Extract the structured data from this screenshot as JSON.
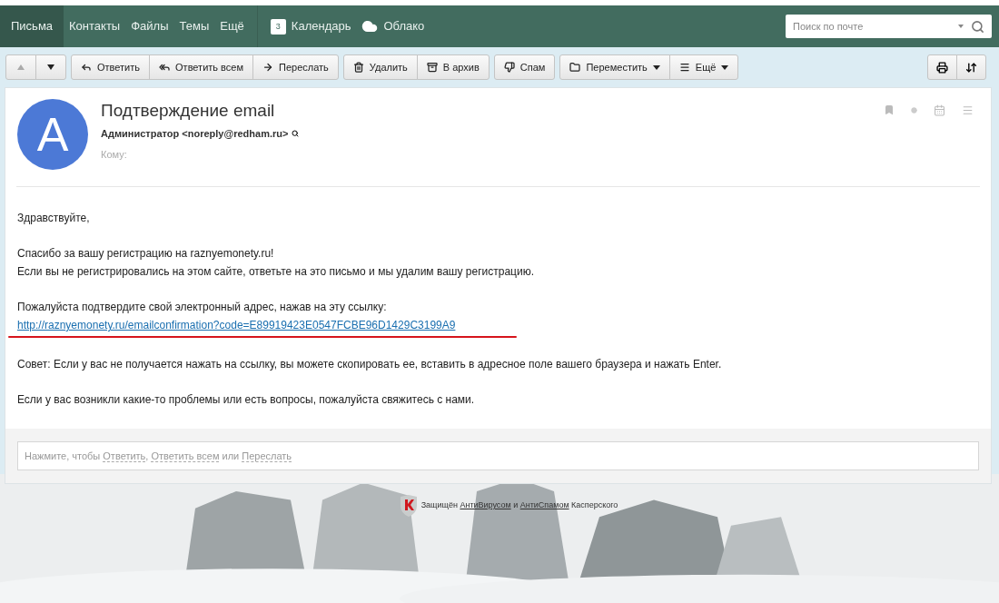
{
  "nav": {
    "items": [
      {
        "label": "Письма",
        "selected": true,
        "kind": "text"
      },
      {
        "label": "Контакты",
        "selected": false,
        "kind": "text"
      },
      {
        "label": "Файлы",
        "selected": false,
        "kind": "text"
      },
      {
        "label": "Темы",
        "selected": false,
        "kind": "text"
      },
      {
        "label": "Ещё",
        "selected": false,
        "kind": "text"
      },
      {
        "label": "Календарь",
        "selected": false,
        "kind": "calendar",
        "badge": "3"
      },
      {
        "label": "Облако",
        "selected": false,
        "kind": "cloud"
      }
    ],
    "search": {
      "placeholder": "Поиск по почте"
    }
  },
  "toolbar": {
    "groups": [
      [
        {
          "kind": "up",
          "disabled": true
        },
        {
          "kind": "down",
          "disabled": false
        }
      ],
      [
        {
          "kind": "reply",
          "label": "Ответить"
        },
        {
          "kind": "reply-all",
          "label": "Ответить всем"
        },
        {
          "kind": "forward",
          "label": "Переслать"
        }
      ],
      [
        {
          "kind": "delete",
          "label": "Удалить"
        },
        {
          "kind": "archive",
          "label": "В архив"
        }
      ],
      [
        {
          "kind": "spam",
          "label": "Спам"
        }
      ],
      [
        {
          "kind": "move",
          "label": "Переместить",
          "dropdown": true
        },
        {
          "kind": "more",
          "label": "Ещё",
          "dropdown": true
        }
      ]
    ],
    "right": [
      {
        "kind": "print"
      },
      {
        "kind": "convert"
      }
    ]
  },
  "message": {
    "avatar": "A",
    "subject": "Подтверждение email",
    "sender": "Администратор <noreply@redham.ru>",
    "to_label": "Кому:",
    "body": [
      {
        "kind": "para",
        "lines": [
          "Здравствуйте,"
        ]
      },
      {
        "kind": "para",
        "lines": [
          "Спасибо за вашу регистрацию на raznyemonety.ru!",
          "Если вы не регистрировались на этом сайте, ответьте на это письмо и мы удалим вашу регистрацию."
        ]
      },
      {
        "kind": "link",
        "lines": [
          "Пожалуйста подтвердите свой электронный адрес, нажав на эту ссылку:"
        ],
        "link": "http://raznyemonety.ru/emailconfirmation?code=E89919423E0547FCBE96D1429C3199A9"
      },
      {
        "kind": "para",
        "lines": [
          "Совет: Если у вас не получается нажать на ссылку, вы можете скопировать ее, вставить в адресное поле вашего браузера и нажать Enter."
        ]
      },
      {
        "kind": "para",
        "lines": [
          "Если у вас возникли какие-то проблемы или есть вопросы, пожалуйста свяжитесь с нами."
        ]
      }
    ]
  },
  "reply_bar": [
    {
      "kind": "text",
      "text": "Нажмите, чтобы "
    },
    {
      "kind": "link",
      "text": "Ответить"
    },
    {
      "kind": "text",
      "text": ", "
    },
    {
      "kind": "link",
      "text": "Ответить всем"
    },
    {
      "kind": "text",
      "text": " или "
    },
    {
      "kind": "link",
      "text": "Переслать"
    }
  ],
  "footer": [
    {
      "kind": "text",
      "text": "Защищён "
    },
    {
      "kind": "link",
      "text": "АнтиВирусом"
    },
    {
      "kind": "text",
      "text": " и "
    },
    {
      "kind": "link",
      "text": "АнтиСпамом"
    },
    {
      "kind": "text",
      "text": " Касперского"
    }
  ]
}
